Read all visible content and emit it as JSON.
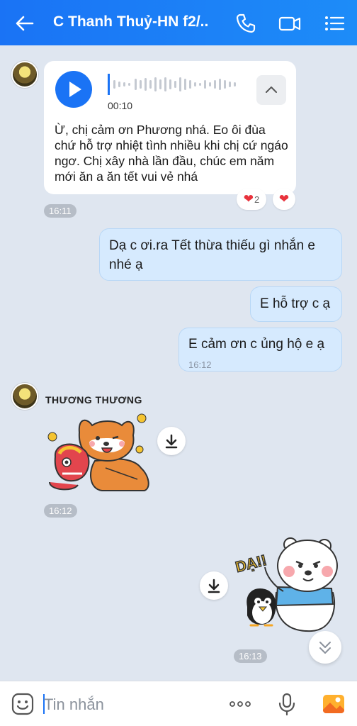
{
  "header": {
    "title": "C Thanh Thuỷ-HN f2/...",
    "icons": [
      "back-arrow-icon",
      "phone-icon",
      "video-call-icon",
      "menu-list-icon"
    ]
  },
  "messages": {
    "voice": {
      "duration": "00:10",
      "text": "Ừ, chị cảm ơn Phương nhá. Eo ôi đùa chứ hỗ trợ nhiệt tình nhiều khi chị cứ ngáo ngơ. Chị xây nhà lần đầu, chúc em năm mới ăn a ăn tết vui vẻ nhá",
      "reaction_count": "2",
      "time": "16:11"
    },
    "out1": {
      "text": "Dạ c ơi.ra Tết thừa thiếu gì nhắn e nhé ạ"
    },
    "out2": {
      "text": "E hỗ trợ c ạ"
    },
    "out3": {
      "text": "E cảm ơn c ủng hộ e ạ",
      "time": "16:12"
    },
    "sticker1": {
      "sender": "THƯƠNG THƯƠNG",
      "time": "16:12"
    },
    "sticker2": {
      "sticker_text": "DẠ!!",
      "time": "16:13"
    }
  },
  "input": {
    "placeholder": "Tin nhắn"
  },
  "colors": {
    "accent": "#1a73f5",
    "header_gradient_end": "#1d8cf8",
    "outgoing_bubble": "#d6eafe",
    "reaction_heart": "#e8323c"
  }
}
